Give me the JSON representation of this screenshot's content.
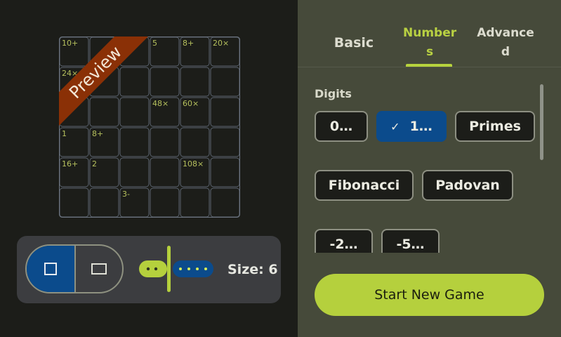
{
  "preview": {
    "ribbon_text": "Preview",
    "cage_labels": [
      {
        "text": "10+",
        "row": 0,
        "col": 0
      },
      {
        "text": "5",
        "row": 0,
        "col": 3
      },
      {
        "text": "8+",
        "row": 0,
        "col": 4
      },
      {
        "text": "20×",
        "row": 0,
        "col": 5
      },
      {
        "text": "24×",
        "row": 1,
        "col": 0
      },
      {
        "text": "48×",
        "row": 2,
        "col": 3
      },
      {
        "text": "60×",
        "row": 2,
        "col": 4
      },
      {
        "text": "1",
        "row": 3,
        "col": 0
      },
      {
        "text": "8+",
        "row": 3,
        "col": 1
      },
      {
        "text": "16+",
        "row": 4,
        "col": 0
      },
      {
        "text": "2",
        "row": 4,
        "col": 1
      },
      {
        "text": "108×",
        "row": 4,
        "col": 4
      },
      {
        "text": "3-",
        "row": 5,
        "col": 2
      }
    ]
  },
  "controls": {
    "shape_square": "square-shape",
    "shape_rectangle": "rectangle-shape",
    "size_label": "Size: 6",
    "size_value": 6
  },
  "tabs": {
    "basic": "Basic",
    "numbers_line1": "Number",
    "numbers_line2": "s",
    "advanced_line1": "Advance",
    "advanced_line2": "d"
  },
  "digits": {
    "title": "Digits",
    "options": [
      {
        "label": "0…",
        "selected": false
      },
      {
        "label": "1…",
        "selected": true
      },
      {
        "label": "Primes",
        "selected": false
      },
      {
        "label": "Fibonacci",
        "selected": false
      },
      {
        "label": "Padovan",
        "selected": false
      },
      {
        "label": "-2…",
        "selected": false
      },
      {
        "label": "-5…",
        "selected": false
      }
    ]
  },
  "start_button": "Start New Game",
  "colors": {
    "accent": "#b5d03d",
    "selected": "#0b4b8c",
    "ribbon": "#8a3006"
  }
}
